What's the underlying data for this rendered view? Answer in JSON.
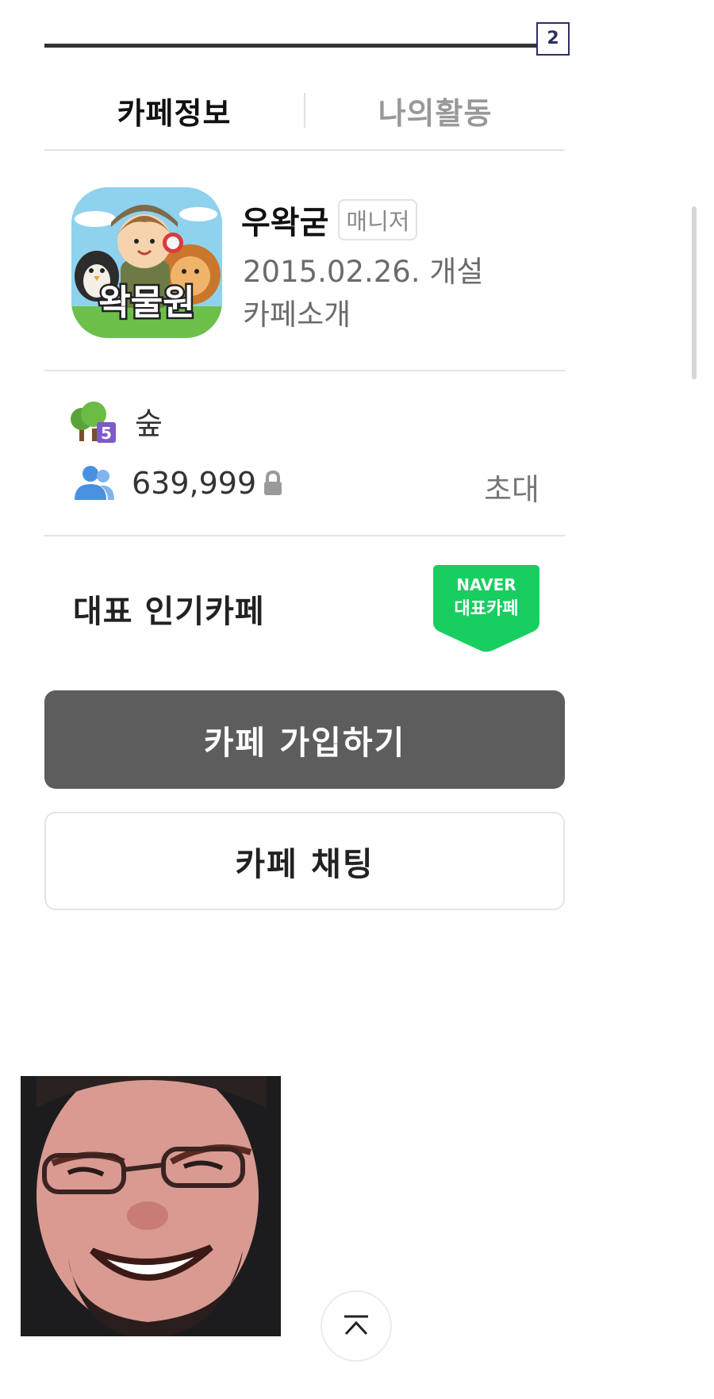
{
  "page_badge": "2",
  "tabs": [
    {
      "label": "카페정보",
      "active": true
    },
    {
      "label": "나의활동",
      "active": false
    }
  ],
  "cafe": {
    "thumbnail_text": "왁물원",
    "name": "우왁굳",
    "role": "매니저",
    "open_date": "2015.02.26. 개설",
    "intro": "카페소개"
  },
  "level": {
    "icon": "tree-level-icon",
    "grade": "5",
    "name": "숲"
  },
  "members": {
    "icon": "members-icon",
    "count": "639,999",
    "locked_icon": "lock-icon",
    "invite_label": "초대"
  },
  "popular": {
    "label": "대표 인기카페",
    "badge_line1": "NAVER",
    "badge_line2": "대표카페",
    "badge_color": "#19ce60"
  },
  "buttons": {
    "join_label": "카페 가입하기",
    "chat_label": "카페 채팅"
  },
  "scroll_top_icon": "chevron-up-icon",
  "colors": {
    "join_button": "#5d5d5d",
    "divider": "#e4e4e4",
    "badge_border": "#2b2f66"
  }
}
